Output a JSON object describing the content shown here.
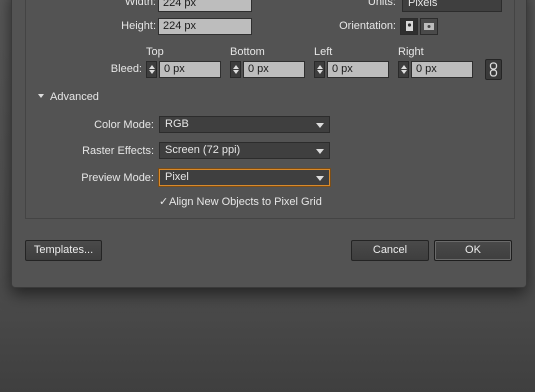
{
  "document": {
    "width_label": "Width:",
    "width_value": "224 px",
    "height_label": "Height:",
    "height_value": "224 px",
    "units_label": "Units:",
    "units_value": "Pixels",
    "orientation_label": "Orientation:",
    "bleed_label": "Bleed:",
    "bleed": {
      "top_header": "Top",
      "top_value": "0 px",
      "bottom_header": "Bottom",
      "bottom_value": "0 px",
      "left_header": "Left",
      "left_value": "0 px",
      "right_header": "Right",
      "right_value": "0 px"
    }
  },
  "advanced": {
    "section_label": "Advanced",
    "color_mode_label": "Color Mode:",
    "color_mode_value": "RGB",
    "raster_effects_label": "Raster Effects:",
    "raster_effects_value": "Screen (72 ppi)",
    "preview_mode_label": "Preview Mode:",
    "preview_mode_value": "Pixel",
    "align_checkbox_label": "Align New Objects to Pixel Grid",
    "align_checked": true
  },
  "buttons": {
    "templates": "Templates...",
    "cancel": "Cancel",
    "ok": "OK"
  },
  "colors": {
    "dialog_bg": "#535353",
    "focus_ring": "#d98a2b",
    "field_bg": "#bdbdbd"
  }
}
